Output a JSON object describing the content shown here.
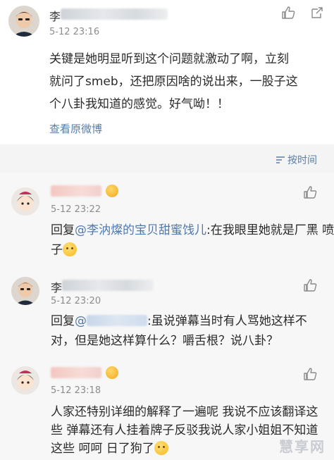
{
  "post": {
    "author_initial": "李",
    "time": "5-12 23:16",
    "lines": [
      "关键是她明显听到这个问题就激动了啊，立刻",
      "就问了smeb，还把原因啥的说出来，一股子这",
      "个八卦我知道的感觉。好气呦！！"
    ],
    "view_original": "查看原微博"
  },
  "sort": {
    "label": "按时间"
  },
  "comments": [
    {
      "time": "5-12 23:22",
      "reply_prefix": "回复",
      "mention": "@李汭燦的宝贝甜蜜饯儿",
      "line1_rest": ":在我眼里她就是厂黑 喷",
      "line2": "子"
    },
    {
      "author_initial": "李",
      "time": "5-12 23:20",
      "reply_prefix": "回复",
      "mention_at": "@",
      "line1_rest": ":虽说弹幕当时有人骂她这样不",
      "line2": "对，但是她这样算什么？嚼舌根？说八卦？"
    },
    {
      "time": "5-12 23:18",
      "lines": [
        "人家还特别详细的解释了一遍呢  我说不应该翻译这",
        "些  弹幕还有人挂着牌子反驳我说人家小姐姐不知道",
        "这些  呵呵 日了狗了"
      ]
    }
  ],
  "watermark": "慧享网",
  "colors": {
    "link": "#5a7ea8",
    "mention": "#4f78ad",
    "time": "#8c8c8c",
    "sortbar": "#f4f4f4"
  }
}
